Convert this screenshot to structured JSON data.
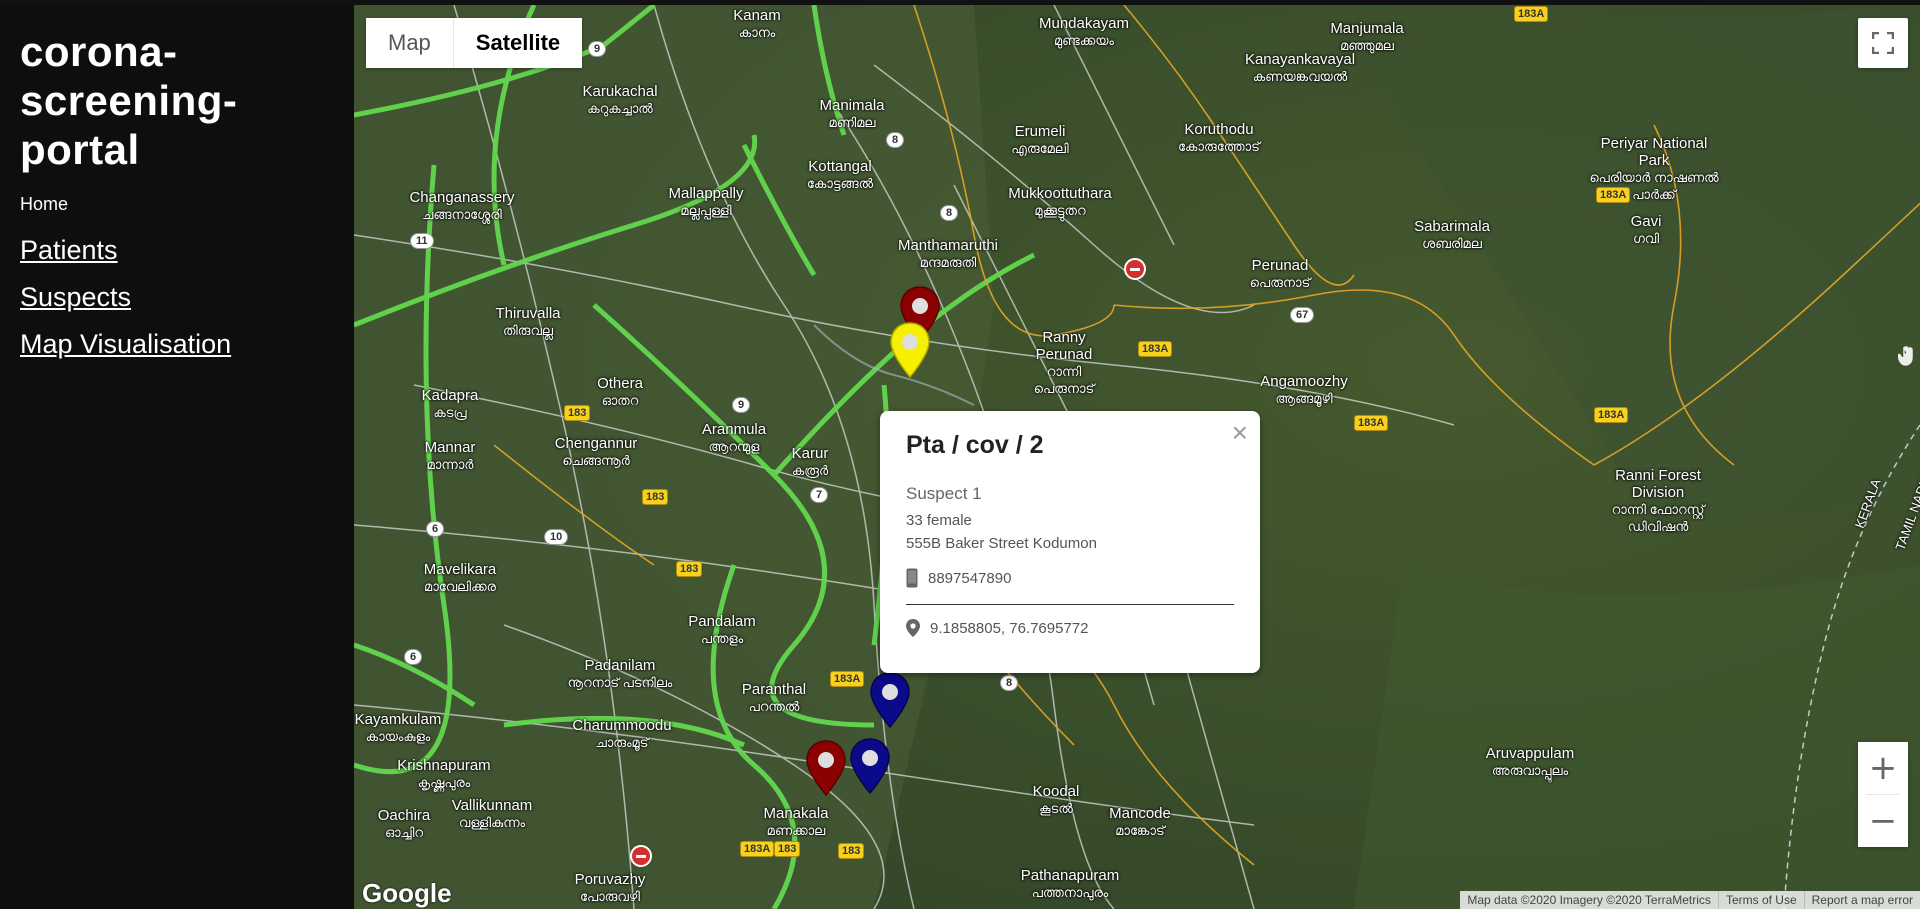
{
  "sidebar": {
    "brand": "corona-screening-portal",
    "home": "Home",
    "nav": [
      "Patients",
      "Suspects",
      "Map Visualisation"
    ]
  },
  "map": {
    "maptype": {
      "map": "Map",
      "satellite": "Satellite"
    },
    "google": "Google",
    "attribution": {
      "data": "Map data ©2020 Imagery ©2020 TerraMetrics",
      "terms": "Terms of Use",
      "report": "Report a map error"
    },
    "places": [
      {
        "en": "Kanam",
        "ml": "കാനം"
      },
      {
        "en": "Mundakayam",
        "ml": "മുണ്ടക്കയം"
      },
      {
        "en": "Manjumala",
        "ml": "മഞ്ഞുമല"
      },
      {
        "en": "Kanayankavayal",
        "ml": "കണയങ്കവയൽ"
      },
      {
        "en": "Karukachal",
        "ml": "കറുകച്ചാൽ"
      },
      {
        "en": "Manimala",
        "ml": "മണിമല"
      },
      {
        "en": "Erumeli",
        "ml": "എരുമേലി"
      },
      {
        "en": "Koruthodu",
        "ml": "കോരുത്തോട്"
      },
      {
        "en": "Periyar National Park",
        "ml": "പെരിയാർ നാഷണൽ പാർക്ക്"
      },
      {
        "en": "Kottangal",
        "ml": "കോട്ടങ്ങൽ"
      },
      {
        "en": "Changanassery",
        "ml": "ചങ്ങനാശ്ശേരി"
      },
      {
        "en": "Mallappally",
        "ml": "മല്ലപ്പള്ളി"
      },
      {
        "en": "Mukkoottuthara",
        "ml": "മുക്കൂട്ടുതറ"
      },
      {
        "en": "Sabarimala",
        "ml": "ശബരിമല"
      },
      {
        "en": "Gavi",
        "ml": "ഗവി"
      },
      {
        "en": "Manthamaruthi",
        "ml": "മന്ദമരുതി"
      },
      {
        "en": "Perunad",
        "ml": "പെരുനാട്"
      },
      {
        "en": "Thiruvalla",
        "ml": "തിരുവല്ല"
      },
      {
        "en": "Ranny Perunad",
        "ml": "റാന്നി പെരുനാട്"
      },
      {
        "en": "Othera",
        "ml": "ഓതറ"
      },
      {
        "en": "Kadapra",
        "ml": "കടപ്ര"
      },
      {
        "en": "Angamoozhy",
        "ml": "ആങ്ങമൂഴി"
      },
      {
        "en": "Mannar",
        "ml": "മാന്നാർ"
      },
      {
        "en": "Chengannur",
        "ml": "ചെങ്ങന്നൂർ"
      },
      {
        "en": "Aranmula",
        "ml": "ആറന്മുള"
      },
      {
        "en": "Karur",
        "ml": "കരൂർ"
      },
      {
        "en": "Ranni Forest Division",
        "ml": "റാന്നി ഫോറസ്റ്റ് ഡിവിഷൻ"
      },
      {
        "en": "Mavelikara",
        "ml": "മാവേലിക്കര"
      },
      {
        "en": "Pandalam",
        "ml": "പന്തളം"
      },
      {
        "en": "Padanilam",
        "ml": "നൂറനാട് പടനിലം"
      },
      {
        "en": "Paranthal",
        "ml": "പറന്തൽ"
      },
      {
        "en": "Charummoodu",
        "ml": "ചാരുംമൂട്"
      },
      {
        "en": "Kayamkulam",
        "ml": "കായംകുളം"
      },
      {
        "en": "Aruvappulam",
        "ml": "അരുവാപ്പുലം"
      },
      {
        "en": "Krishnapuram",
        "ml": "കൃഷ്ണപുരം"
      },
      {
        "en": "Koodal",
        "ml": "കൂടൽ"
      },
      {
        "en": "Mancode",
        "ml": "മാങ്കോട്"
      },
      {
        "en": "Vallikunnam",
        "ml": "വള്ളികുന്നം"
      },
      {
        "en": "Oachira",
        "ml": "ഓച്ചിറ"
      },
      {
        "en": "Manakala",
        "ml": "മണക്കാല"
      },
      {
        "en": "Poruvazhy",
        "ml": "പോരുവഴി"
      },
      {
        "en": "Pathanapuram",
        "ml": "പത്തനാപുരം"
      }
    ],
    "state_labels": [
      "KERALA",
      "TAMIL NADU"
    ],
    "road_numbers": [
      "9",
      "8",
      "8",
      "183A",
      "183A",
      "183A",
      "183A",
      "183A",
      "183A",
      "67",
      "11",
      "183",
      "9",
      "183",
      "7",
      "183",
      "183",
      "10",
      "6",
      "6",
      "8",
      "183",
      "183A"
    ],
    "pin_colors": {
      "red": "#8b0000",
      "yellow": "#f4f000",
      "blue": "#0a0a8a"
    }
  },
  "info_window": {
    "title": "Pta / cov / 2",
    "name": "Suspect 1",
    "age_gender": "33 female",
    "address": "555B Baker Street Kodumon",
    "phone": "8897547890",
    "coords": "9.1858805, 76.7695772",
    "close": "×"
  }
}
